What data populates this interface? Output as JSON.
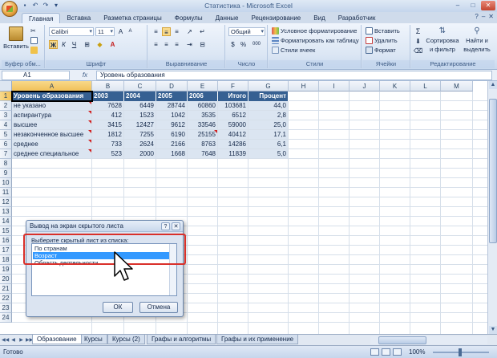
{
  "window": {
    "title": "Статистика - Microsoft Excel"
  },
  "ribbon": {
    "tabs": [
      "Главная",
      "Вставка",
      "Разметка страницы",
      "Формулы",
      "Данные",
      "Рецензирование",
      "Вид",
      "Разработчик"
    ],
    "active_tab": "Главная",
    "groups": {
      "clipboard": {
        "label": "Буфер обм...",
        "paste": "Вставить"
      },
      "font": {
        "label": "Шрифт",
        "name": "Calibri",
        "size": "11"
      },
      "alignment": {
        "label": "Выравнивание"
      },
      "number": {
        "label": "Число",
        "format": "Общий",
        "pct": "%",
        "thousands": "000"
      },
      "styles": {
        "label": "Стили",
        "conditional": "Условное форматирование",
        "as_table": "Форматировать как таблицу",
        "cell_styles": "Стили ячеек"
      },
      "cells": {
        "label": "Ячейки",
        "insert": "Вставить",
        "delete": "Удалить",
        "format": "Формат"
      },
      "editing": {
        "label": "Редактирование",
        "sort": "Сортировка",
        "sort2": "и фильтр",
        "find": "Найти и",
        "find2": "выделить"
      }
    }
  },
  "formula_bar": {
    "name_box": "A1",
    "fx": "fx",
    "value": "Уровень образования"
  },
  "sheet": {
    "columns": [
      "A",
      "B",
      "C",
      "D",
      "E",
      "F",
      "G",
      "H",
      "I",
      "J",
      "K",
      "L",
      "M"
    ],
    "rows": [
      "1",
      "2",
      "3",
      "4",
      "5",
      "6",
      "7",
      "8",
      "9",
      "10",
      "11",
      "12",
      "13",
      "14",
      "15",
      "16",
      "17",
      "18",
      "19",
      "20",
      "21",
      "22",
      "23",
      "24"
    ],
    "header_row": [
      "Уровень образования",
      "2003",
      "2004",
      "2005",
      "2006",
      "Итого",
      "Процент"
    ],
    "data": [
      [
        "не указано",
        "7628",
        "6449",
        "28744",
        "60860",
        "103681",
        "44,0"
      ],
      [
        "аспирантура",
        "412",
        "1523",
        "1042",
        "3535",
        "6512",
        "2,8"
      ],
      [
        "высшее",
        "3415",
        "12427",
        "9612",
        "33546",
        "59000",
        "25,0"
      ],
      [
        "незаконченное высшее",
        "1812",
        "7255",
        "6190",
        "25155",
        "40412",
        "17,1"
      ],
      [
        "среднее",
        "733",
        "2624",
        "2166",
        "8763",
        "14286",
        "6,1"
      ],
      [
        "среднее специальное",
        "523",
        "2000",
        "1668",
        "7648",
        "11839",
        "5,0"
      ]
    ]
  },
  "sheet_tabs": [
    "Образование",
    "Курсы",
    "Курсы (2)",
    "Графы и алгоритмы",
    "Графы и их применение"
  ],
  "active_sheet": "Образование",
  "status": {
    "ready": "Готово",
    "zoom": "100%"
  },
  "dialog": {
    "title": "Вывод на экран скрытого листа",
    "help": "?",
    "close": "✕",
    "prompt": "Выберите скрытый лист из списка:",
    "items": [
      "По странам",
      "Возраст",
      "Область деятельности"
    ],
    "selected": "Возраст",
    "ok": "ОК",
    "cancel": "Отмена"
  }
}
